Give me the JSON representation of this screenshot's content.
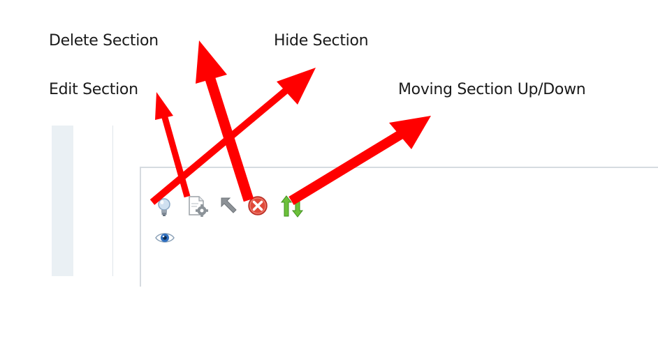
{
  "annotations": {
    "delete": "Delete Section",
    "hide": "Hide Section",
    "edit": "Edit Section",
    "move": "Moving Section Up/Down"
  },
  "toolbar": {
    "icons": [
      "lightbulb-icon",
      "page-settings-icon",
      "move-arrow-icon",
      "delete-icon",
      "up-down-arrows-icon",
      "eye-icon"
    ]
  },
  "colors": {
    "arrow": "#ff0000",
    "delete_icon": "#e04a3a",
    "updown_icon": "#5fbf2f",
    "eye_icon": "#2f6fbf"
  }
}
